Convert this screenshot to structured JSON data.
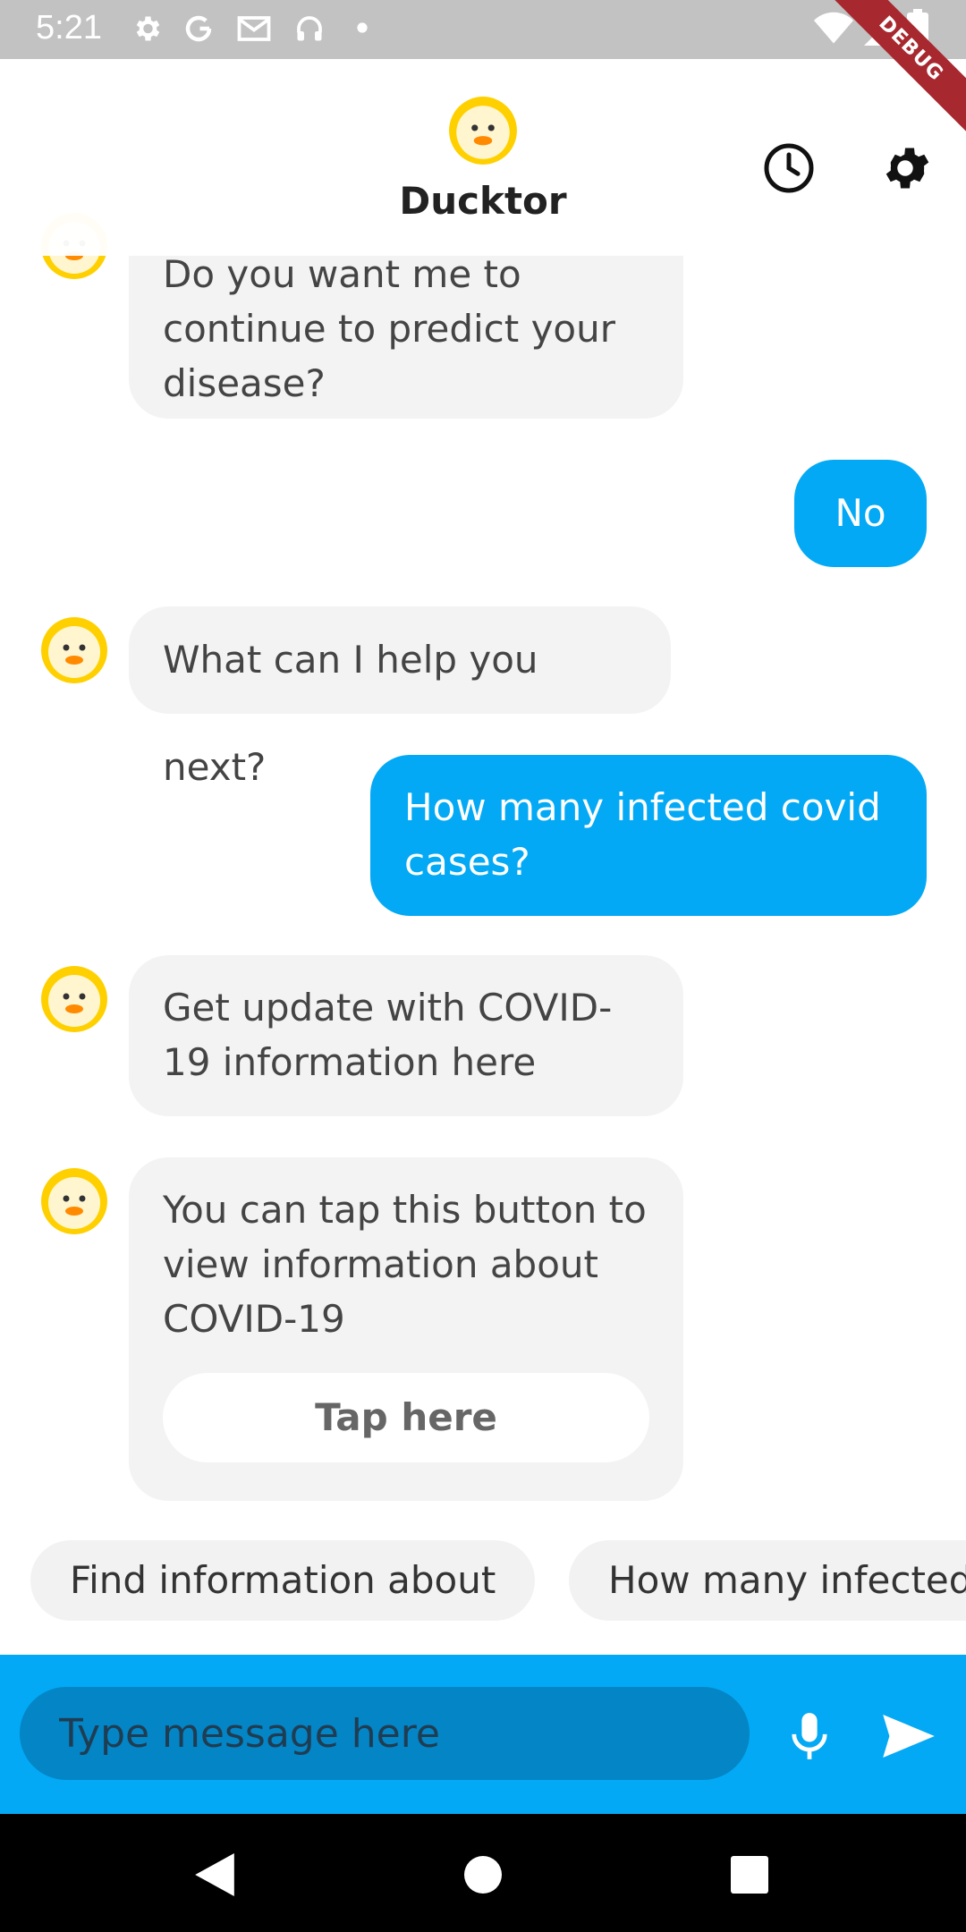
{
  "status_bar": {
    "time": "5:21",
    "debug_label": "DEBUG",
    "icons": [
      "gear-icon",
      "google-icon",
      "gmail-icon",
      "headphones-icon",
      "dot-icon",
      "wifi-icon",
      "signal-icon",
      "battery-icon"
    ]
  },
  "app_bar": {
    "title": "Ducktor",
    "logo_icon": "duck-icon",
    "actions": [
      "history-icon",
      "settings-icon"
    ]
  },
  "colors": {
    "accent": "#03a9f4",
    "bot_bubble": "#f3f3f3",
    "avatar_yellow": "#ffd000"
  },
  "messages": [
    {
      "from": "bot",
      "text": "Do you want me to continue to predict your disease?"
    },
    {
      "from": "user",
      "text": "No"
    },
    {
      "from": "bot",
      "text": "What can I help you next?"
    },
    {
      "from": "user",
      "text": "How many infected covid cases?"
    },
    {
      "from": "bot",
      "text": "Get update with COVID-19 information here"
    },
    {
      "from": "bot",
      "text": "You can tap this button to view information about COVID-19",
      "button": "Tap here"
    }
  ],
  "suggestions": [
    "Find information about",
    "How many infected"
  ],
  "input": {
    "placeholder": "Type message here",
    "mic_icon": "microphone-icon",
    "send_icon": "send-icon"
  },
  "nav": [
    "back-icon",
    "home-icon",
    "recents-icon"
  ]
}
